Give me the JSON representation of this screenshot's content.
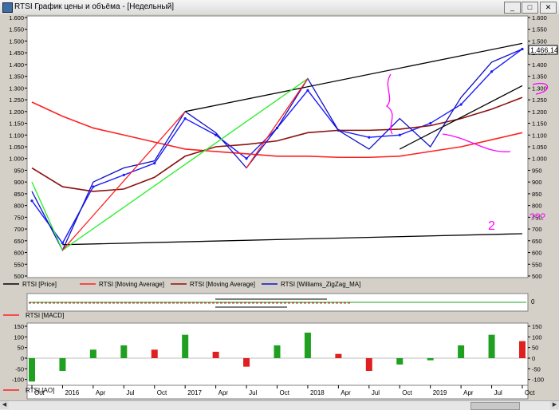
{
  "window": {
    "title": "RTSI График цены и объёма - [Недельный]",
    "buttons": {
      "minimize": "_",
      "maximize": "□",
      "close": "✕"
    }
  },
  "colors": {
    "price": "#1a1aff",
    "ma_red": "#ff2020",
    "ma_dark": "#8b1010",
    "zigzag": "#1010c8",
    "trend_green": "#33ee33",
    "trend_red": "#ff2020",
    "trend_black": "#000000",
    "annot": "#ff00ff",
    "hist_pos": "#20a020",
    "hist_neg": "#e02020"
  },
  "main": {
    "price_label": "1.466,14",
    "y_ticks": [
      "1.600",
      "1.550",
      "1.500",
      "1.450",
      "1.400",
      "1.350",
      "1.300",
      "1.250",
      "1.200",
      "1.150",
      "1.100",
      "1.050",
      "1.000",
      "950",
      "900",
      "850",
      "800",
      "750",
      "700",
      "650",
      "600",
      "550",
      "500"
    ],
    "y_values": [
      1600,
      1550,
      1500,
      1450,
      1400,
      1350,
      1300,
      1250,
      1200,
      1150,
      1100,
      1050,
      1000,
      950,
      900,
      850,
      800,
      750,
      700,
      650,
      600,
      550,
      500
    ],
    "legend": [
      "RTSI [Price]",
      "RTSI [Moving Average]",
      "RTSI [Moving Average]",
      "RTSI [Williams_ZigZag_MA]"
    ],
    "annotations": [
      "2",
      "???"
    ]
  },
  "macd": {
    "label": "RTSI [MACD]",
    "tick": "0"
  },
  "ao": {
    "label": "RTSI [AO]",
    "y_ticks": [
      "150",
      "100",
      "50",
      "0",
      "-50",
      "-100"
    ],
    "y_values": [
      150,
      100,
      50,
      0,
      -50,
      -100
    ]
  },
  "x_axis": [
    "Oct",
    "2016",
    "Apr",
    "Jul",
    "Oct",
    "2017",
    "Apr",
    "Jul",
    "Oct",
    "2018",
    "Apr",
    "Jul",
    "Oct",
    "2019",
    "Apr",
    "Jul",
    "Oct"
  ],
  "chart_data": {
    "type": "line",
    "title": "RTSI График цены и объёма - [Недельный]",
    "x": [
      "Oct 2015",
      "Jan 2016",
      "Apr 2016",
      "Jul 2016",
      "Oct 2016",
      "Jan 2017",
      "Apr 2017",
      "Jul 2017",
      "Oct 2017",
      "Jan 2018",
      "Apr 2018",
      "Jul 2018",
      "Oct 2018",
      "Jan 2019",
      "Apr 2019",
      "Jul 2019",
      "Oct 2019"
    ],
    "ylim": [
      500,
      1600
    ],
    "series": [
      {
        "name": "RTSI [Price]",
        "values": [
          820,
          640,
          880,
          930,
          980,
          1170,
          1100,
          1000,
          1130,
          1290,
          1120,
          1090,
          1100,
          1150,
          1230,
          1370,
          1466
        ]
      },
      {
        "name": "RTSI [Moving Average]",
        "values": [
          1240,
          1180,
          1130,
          1100,
          1070,
          1040,
          1030,
          1020,
          1010,
          1010,
          1005,
          1005,
          1010,
          1030,
          1050,
          1080,
          1110
        ]
      },
      {
        "name": "RTSI [Moving Average]",
        "values": [
          960,
          880,
          860,
          870,
          920,
          1010,
          1050,
          1060,
          1075,
          1110,
          1120,
          1120,
          1125,
          1140,
          1170,
          1210,
          1260
        ]
      },
      {
        "name": "RTSI [Williams_ZigZag_MA]",
        "values": [
          860,
          610,
          900,
          960,
          990,
          1200,
          1110,
          960,
          1130,
          1340,
          1120,
          1040,
          1170,
          1050,
          1260,
          1410,
          1466
        ]
      }
    ],
    "ao": [
      -110,
      -60,
      40,
      60,
      40,
      110,
      30,
      -40,
      60,
      120,
      20,
      -60,
      -30,
      -10,
      60,
      110,
      80
    ]
  }
}
